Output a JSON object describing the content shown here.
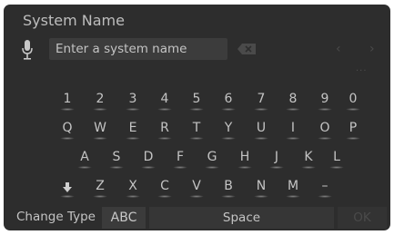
{
  "header": {
    "title": "System Name"
  },
  "input": {
    "placeholder": "Enter a system name",
    "value": ""
  },
  "icons": {
    "mic": "microphone-icon",
    "delete": "backspace-icon",
    "prev": "chevron-left-icon",
    "next": "chevron-right-icon",
    "more": "ellipsis-icon",
    "shift": "arrow-down-icon"
  },
  "nav": {
    "prev": "‹",
    "next": "›",
    "more": "···"
  },
  "keyboard": {
    "rows": [
      [
        "1",
        "2",
        "3",
        "4",
        "5",
        "6",
        "7",
        "8",
        "9",
        "0"
      ],
      [
        "Q",
        "W",
        "E",
        "R",
        "T",
        "Y",
        "U",
        "I",
        "O",
        "P"
      ],
      [
        "A",
        "S",
        "D",
        "F",
        "G",
        "H",
        "J",
        "K",
        "L"
      ],
      [
        "Z",
        "X",
        "C",
        "V",
        "B",
        "N",
        "M",
        "–"
      ]
    ]
  },
  "bottom": {
    "change_type": "Change Type",
    "abc": "ABC",
    "space": "Space",
    "ok": "OK"
  },
  "colors": {
    "background": "#2d2d2d",
    "text": "#c4c4c4",
    "disabled": "#4a4a4a"
  }
}
